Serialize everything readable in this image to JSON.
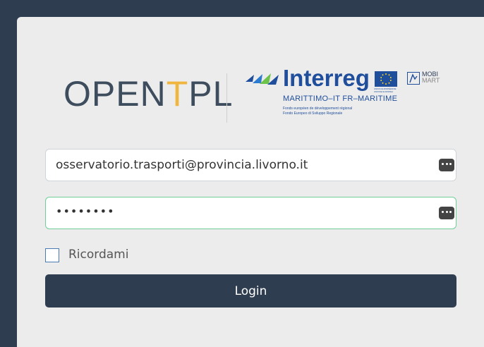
{
  "logos": {
    "opentpl_prefix": "OPEN",
    "opentpl_t": "T",
    "opentpl_suffix": "PL",
    "interreg_word": "Interreg",
    "interreg_sub": "MARITTIMO–IT FR–MARITIME",
    "fonds_line1": "Fonds européen de développement régional",
    "fonds_line2": "Fondo Europeo di Sviluppo Regionale",
    "eu_caption": "UNION EUROPÉENNE UNIONE EUROPEA",
    "mobi": "MOBI",
    "mart": "MART"
  },
  "form": {
    "email_value": "osservatorio.trasporti@provincia.livorno.it",
    "password_value": "••••••••",
    "remember_label": "Ricordami",
    "remember_checked": false,
    "login_label": "Login",
    "password_manager_icon": "key-dots-icon"
  },
  "colors": {
    "background": "#2f3d51",
    "card": "#ececec",
    "accent_yellow": "#f0b53d",
    "interreg_blue": "#1f4e9c",
    "focus_border": "#6fcf97",
    "button": "#2f3d51"
  }
}
